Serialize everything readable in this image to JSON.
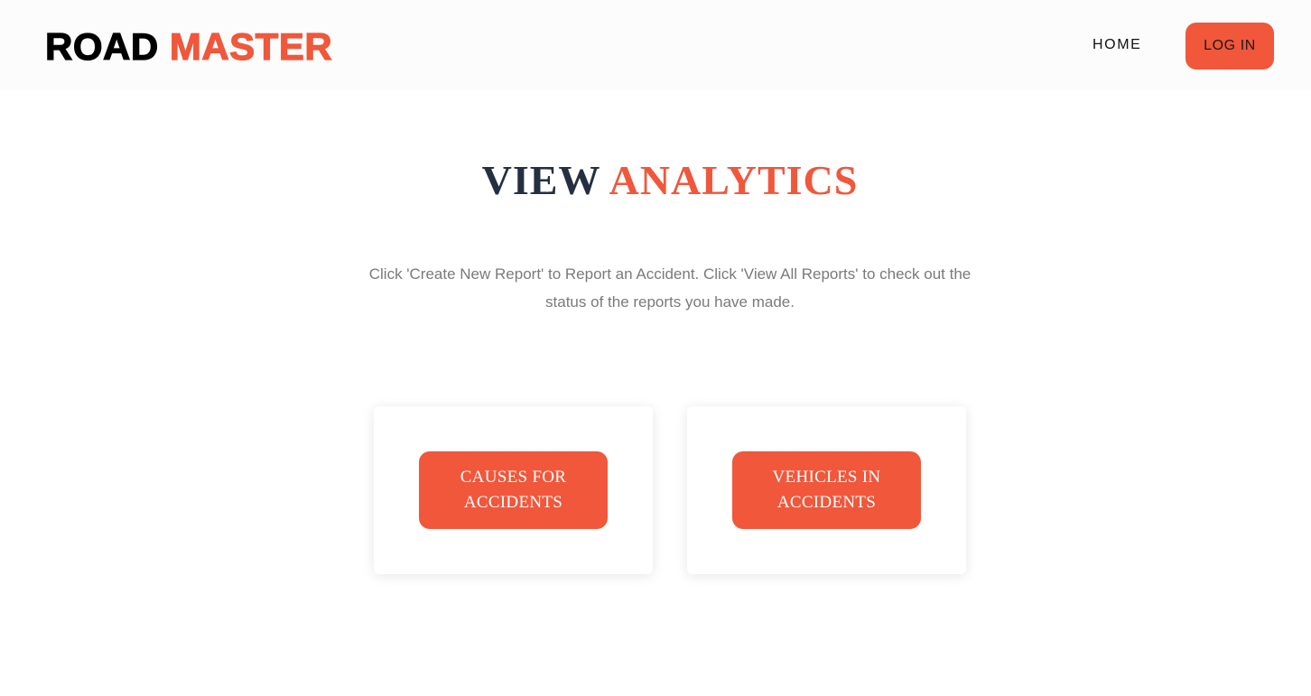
{
  "header": {
    "logo_part1": "ROAD",
    "logo_part2": "MASTER",
    "nav_home": "HOME",
    "login_label": "LOG IN"
  },
  "main": {
    "title_part1": "VIEW",
    "title_part2": "ANALYTICS",
    "description": "Click 'Create New Report' to Report an Accident. Click 'View All Reports' to check out the status of the reports you have made.",
    "cards": [
      {
        "label": "CAUSES FOR ACCIDENTS"
      },
      {
        "label": "VEHICLES IN ACCIDENTS"
      }
    ]
  },
  "colors": {
    "accent": "#f0573b",
    "title_dark": "#243041",
    "text_muted": "#7a7a7a"
  }
}
